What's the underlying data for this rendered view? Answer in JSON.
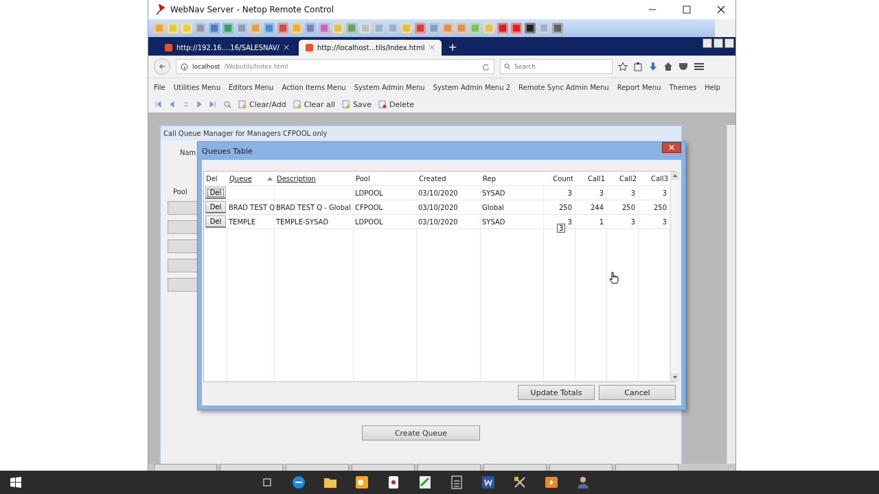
{
  "window": {
    "title": "WebNav Server - Netop Remote Control"
  },
  "browser_tabs": [
    {
      "label": "http://192.16....16/SALESNAV/",
      "selected": false
    },
    {
      "label": "http://localhost...tils/Index.html",
      "selected": true
    }
  ],
  "new_tab": "+",
  "address": {
    "host": "localhost",
    "path": "/Webutils/Index.html"
  },
  "search": {
    "placeholder": "Search"
  },
  "menu": [
    "File",
    "Utilities Menu",
    "Editors Menu",
    "Action Items Menu",
    "System Admin Menu",
    "System Admin Menu 2",
    "Remote Sync Admin Menu",
    "Report Menu",
    "Themes",
    "Help"
  ],
  "nav_toolbar": [
    "Clear/Add",
    "Clear all",
    "Save",
    "Delete"
  ],
  "background_window": {
    "title": "Call Queue Manager for Managers CFPOOL only",
    "name_label": "Nam",
    "pool_label": "Pool",
    "button": "Create Queue"
  },
  "dialog": {
    "title": "Queues Table",
    "columns": [
      {
        "label": "Del",
        "kind": "button",
        "link": false,
        "sorted": false
      },
      {
        "label": "Queue",
        "kind": "text",
        "link": true,
        "sorted": true
      },
      {
        "label": "Description",
        "kind": "text",
        "link": true,
        "sorted": false
      },
      {
        "label": "Pool",
        "kind": "text",
        "link": false,
        "sorted": false
      },
      {
        "label": "Created",
        "kind": "text",
        "link": false,
        "sorted": false
      },
      {
        "label": "Rep",
        "kind": "text",
        "link": false,
        "sorted": false
      },
      {
        "label": "Count",
        "kind": "number",
        "link": false,
        "sorted": false
      },
      {
        "label": "Call1",
        "kind": "number",
        "link": false,
        "sorted": false
      },
      {
        "label": "Call2",
        "kind": "number",
        "link": false,
        "sorted": false
      },
      {
        "label": "Call3",
        "kind": "number",
        "link": false,
        "sorted": false
      }
    ],
    "rows": [
      {
        "focused": true,
        "cells": [
          "Del",
          "",
          "",
          "LDPOOL",
          "03/10/2020",
          "SYSAD",
          "3",
          "3",
          "3",
          "3"
        ]
      },
      {
        "focused": false,
        "cells": [
          "Del",
          "BRAD TEST Q",
          "BRAD TEST Q - Global",
          "CFPOOL",
          "03/10/2020",
          "Global",
          "250",
          "244",
          "250",
          "250"
        ]
      },
      {
        "focused": false,
        "cells": [
          "Del",
          "TEMPLE",
          "TEMPLE-SYSAD",
          "LDPOOL",
          "03/10/2020",
          "SYSAD",
          "3",
          "1",
          "3",
          "3"
        ]
      }
    ],
    "tooltip": "3",
    "buttons": [
      "Update Totals",
      "Cancel"
    ]
  }
}
